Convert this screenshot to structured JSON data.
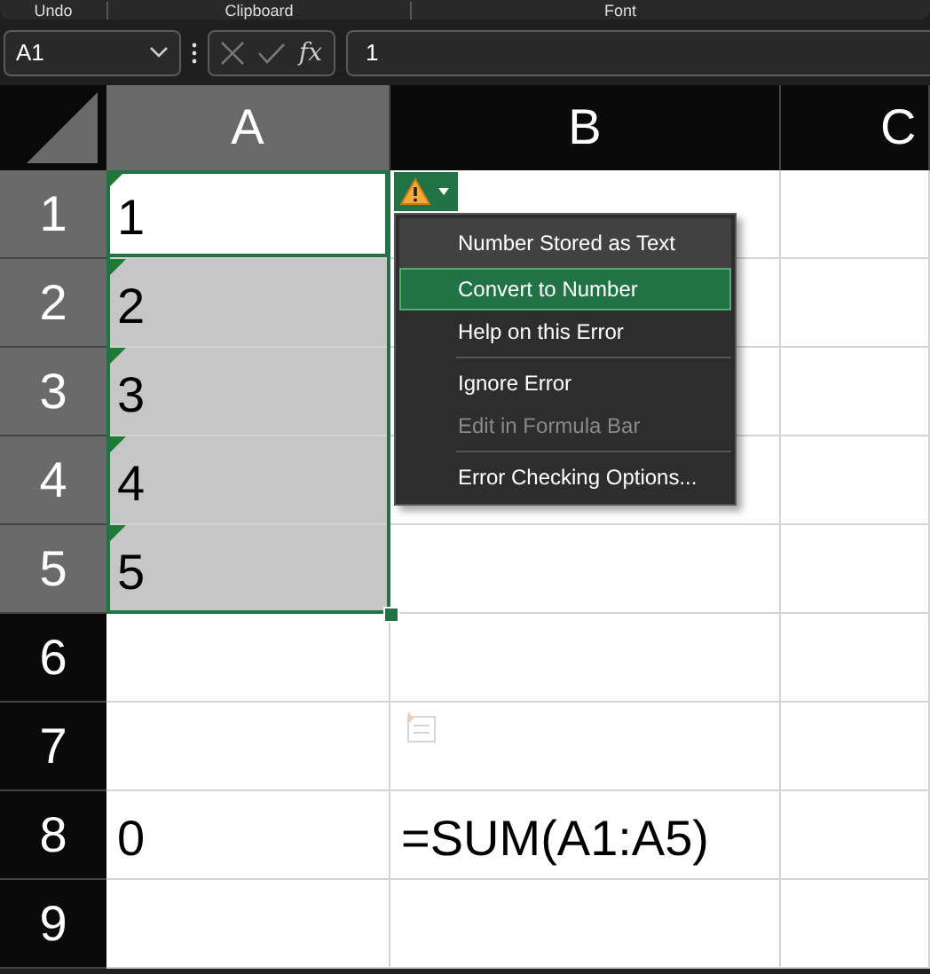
{
  "ribbon": {
    "groups": [
      "Undo",
      "Clipboard",
      "Font"
    ]
  },
  "formula_bar": {
    "name_box": "A1",
    "formula_button": "fx",
    "value": "1"
  },
  "sheet": {
    "columns": [
      {
        "label": "A",
        "selected": true
      },
      {
        "label": "B",
        "selected": false
      },
      {
        "label": "C",
        "selected": false
      }
    ],
    "rows": [
      {
        "label": "1",
        "selected": true,
        "cells": [
          {
            "text": "1",
            "error": true,
            "active": true
          },
          {
            "text": "",
            "error": false,
            "active": false
          }
        ]
      },
      {
        "label": "2",
        "selected": true,
        "cells": [
          {
            "text": "2",
            "error": true,
            "active": false
          },
          {
            "text": "",
            "error": false,
            "active": false
          }
        ]
      },
      {
        "label": "3",
        "selected": true,
        "cells": [
          {
            "text": "3",
            "error": true,
            "active": false
          },
          {
            "text": "",
            "error": false,
            "active": false
          }
        ]
      },
      {
        "label": "4",
        "selected": true,
        "cells": [
          {
            "text": "4",
            "error": true,
            "active": false
          },
          {
            "text": "",
            "error": false,
            "active": false
          }
        ]
      },
      {
        "label": "5",
        "selected": true,
        "cells": [
          {
            "text": "5",
            "error": true,
            "active": false
          },
          {
            "text": "",
            "error": false,
            "active": false
          }
        ]
      },
      {
        "label": "6",
        "selected": false,
        "cells": [
          {
            "text": "",
            "error": false,
            "active": false
          },
          {
            "text": "",
            "error": false,
            "active": false
          }
        ]
      },
      {
        "label": "7",
        "selected": false,
        "cells": [
          {
            "text": "",
            "error": false,
            "active": false
          },
          {
            "text": "",
            "error": false,
            "active": false
          }
        ]
      },
      {
        "label": "8",
        "selected": false,
        "cells": [
          {
            "text": "0",
            "error": false,
            "active": false
          },
          {
            "text": "=SUM(A1:A5)",
            "error": false,
            "active": false
          }
        ]
      },
      {
        "label": "9",
        "selected": false,
        "cells": [
          {
            "text": "",
            "error": false,
            "active": false
          },
          {
            "text": "",
            "error": false,
            "active": false
          }
        ]
      }
    ]
  },
  "error_menu": {
    "items": [
      {
        "kind": "header",
        "label": "Number Stored as Text"
      },
      {
        "kind": "item",
        "label": "Convert to Number",
        "selected": true,
        "disabled": false
      },
      {
        "kind": "item",
        "label": "Help on this Error",
        "selected": false,
        "disabled": false
      },
      {
        "kind": "separator"
      },
      {
        "kind": "item",
        "label": "Ignore Error",
        "selected": false,
        "disabled": false
      },
      {
        "kind": "item",
        "label": "Edit in Formula Bar",
        "selected": false,
        "disabled": true
      },
      {
        "kind": "separator"
      },
      {
        "kind": "item",
        "label": "Error Checking Options...",
        "selected": false,
        "disabled": false
      }
    ]
  }
}
